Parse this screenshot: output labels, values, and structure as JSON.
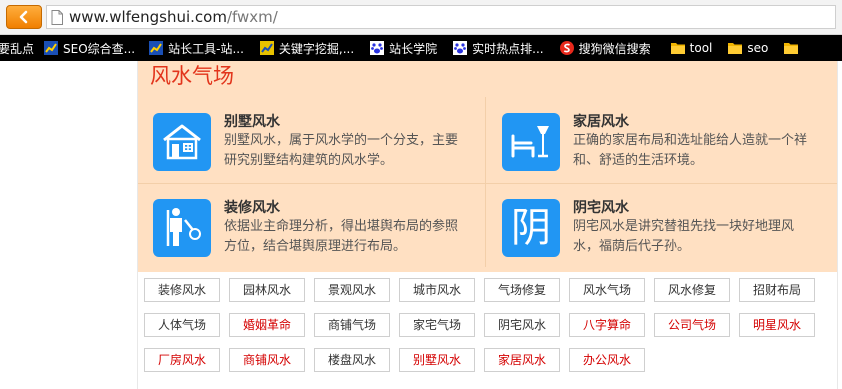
{
  "browser": {
    "url_host": "www.wlfengshui.com",
    "url_path": "/fwxm/"
  },
  "bookmarks": [
    {
      "label": "要乱点",
      "icon": "none"
    },
    {
      "label": "SEO综合查...",
      "icon": "chart-icon"
    },
    {
      "label": "站长工具-站...",
      "icon": "chart-icon"
    },
    {
      "label": "关键字挖掘,...",
      "icon": "chart-icon"
    },
    {
      "label": "站长学院",
      "icon": "paw-icon"
    },
    {
      "label": "实时热点排...",
      "icon": "paw-icon"
    },
    {
      "label": "搜狗微信搜索",
      "icon": "sogou-icon"
    },
    {
      "label": "tool",
      "icon": "folder-icon"
    },
    {
      "label": "seo",
      "icon": "folder-icon"
    }
  ],
  "section": {
    "title": "风水气场",
    "cards": [
      {
        "title": "别墅风水",
        "desc": "别墅风水，属于风水学的一个分支，主要研究别墅结构建筑的风水学。",
        "icon": "villa-icon"
      },
      {
        "title": "家居风水",
        "desc": "正确的家居布局和选址能给人造就一个祥和、舒适的生活环境。",
        "icon": "furniture-icon"
      },
      {
        "title": "装修风水",
        "desc": "依据业主命理分析，得出堪舆布局的参照方位，结合堪舆原理进行布局。",
        "icon": "worker-icon"
      },
      {
        "title": "阴宅风水",
        "desc": "阴宅风水是讲究替祖先找一块好地理风水，福荫后代子孙。",
        "icon": "yin-character-icon",
        "glyph": "阴"
      }
    ]
  },
  "tags": [
    {
      "label": "装修风水",
      "color": "#333333"
    },
    {
      "label": "园林风水",
      "color": "#333333"
    },
    {
      "label": "景观风水",
      "color": "#333333"
    },
    {
      "label": "城市风水",
      "color": "#333333"
    },
    {
      "label": "气场修复",
      "color": "#333333"
    },
    {
      "label": "风水气场",
      "color": "#333333"
    },
    {
      "label": "风水修复",
      "color": "#333333"
    },
    {
      "label": "招财布局",
      "color": "#333333"
    },
    {
      "label": "人体气场",
      "color": "#333333"
    },
    {
      "label": "婚姻革命",
      "color": "#d40000"
    },
    {
      "label": "商铺气场",
      "color": "#333333"
    },
    {
      "label": "家宅气场",
      "color": "#333333"
    },
    {
      "label": "阴宅风水",
      "color": "#333333"
    },
    {
      "label": "八字算命",
      "color": "#d40000"
    },
    {
      "label": "公司气场",
      "color": "#d40000"
    },
    {
      "label": "明星风水",
      "color": "#d40000"
    },
    {
      "label": "厂房风水",
      "color": "#d40000"
    },
    {
      "label": "商铺风水",
      "color": "#d40000"
    },
    {
      "label": "楼盘风水",
      "color": "#333333"
    },
    {
      "label": "别墅风水",
      "color": "#d40000"
    },
    {
      "label": "家居风水",
      "color": "#d40000"
    },
    {
      "label": "办公风水",
      "color": "#d40000"
    }
  ],
  "colors": {
    "accent_red": "#e2341b",
    "panel_bg": "#ffe0c2",
    "icon_blue": "#2196f3",
    "back_button": "#f08a00"
  }
}
